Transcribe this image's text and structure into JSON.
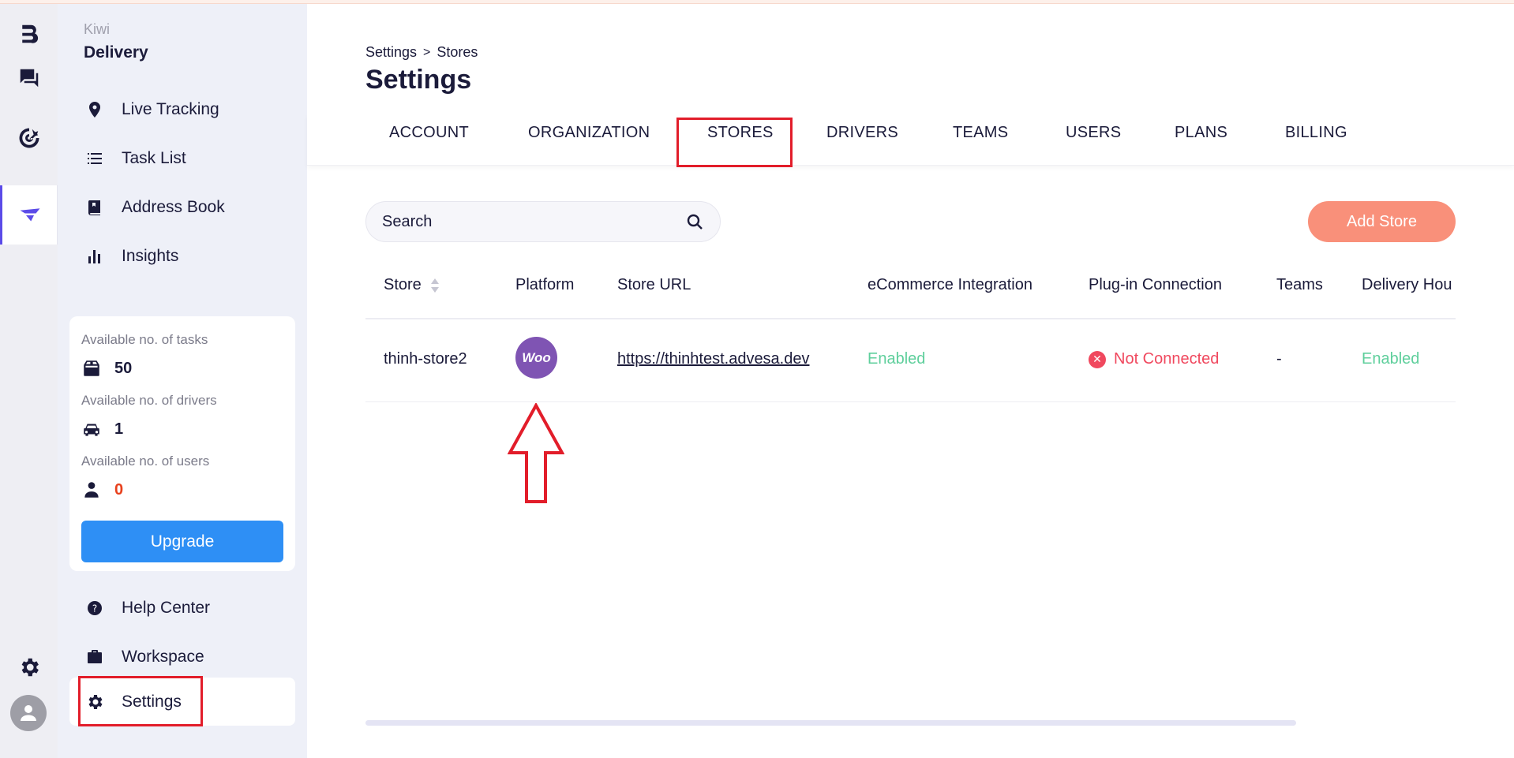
{
  "brand": {
    "workspace_name": "Kiwi",
    "app_name": "Delivery"
  },
  "rail": {
    "icons": [
      "logo-icon",
      "chat-icon",
      "target-icon",
      "dispatch-icon",
      "gear-icon",
      "user-avatar-icon"
    ]
  },
  "sidebar": {
    "items": [
      {
        "label": "Live Tracking",
        "icon": "map-pin-icon"
      },
      {
        "label": "Task List",
        "icon": "list-icon"
      },
      {
        "label": "Address Book",
        "icon": "book-icon"
      },
      {
        "label": "Insights",
        "icon": "bar-chart-icon"
      }
    ],
    "bottom_items": [
      {
        "label": "Help Center",
        "icon": "help-icon"
      },
      {
        "label": "Workspace",
        "icon": "briefcase-icon"
      },
      {
        "label": "Settings",
        "icon": "gear-icon"
      }
    ]
  },
  "usage": {
    "tasks_label": "Available no. of tasks",
    "tasks_value": "50",
    "drivers_label": "Available no. of drivers",
    "drivers_value": "1",
    "users_label": "Available no. of users",
    "users_value": "0",
    "upgrade_label": "Upgrade"
  },
  "breadcrumb": {
    "root": "Settings",
    "separator": ">",
    "current": "Stores"
  },
  "page_title": "Settings",
  "tabs": [
    {
      "label": "ACCOUNT"
    },
    {
      "label": "ORGANIZATION"
    },
    {
      "label": "STORES"
    },
    {
      "label": "DRIVERS"
    },
    {
      "label": "TEAMS"
    },
    {
      "label": "USERS"
    },
    {
      "label": "PLANS"
    },
    {
      "label": "BILLING"
    }
  ],
  "search": {
    "placeholder": "Search"
  },
  "add_store_label": "Add Store",
  "table": {
    "columns": [
      "Store",
      "Platform",
      "Store URL",
      "eCommerce Integration",
      "Plug-in Connection",
      "Teams",
      "Delivery Hou"
    ],
    "rows": [
      {
        "store": "thinh-store2",
        "platform_logo_text": "Woo",
        "store_url": "https://thinhtest.advesa.dev",
        "ecommerce_integration": "Enabled",
        "plugin_connection": "Not Connected",
        "teams": "-",
        "delivery_hours": "Enabled"
      }
    ]
  },
  "colors": {
    "accent": "#5b4be8",
    "upgrade": "#2e8ff5",
    "add_store": "#f9907a",
    "enabled": "#5fcf9c",
    "not_connected": "#f0485e",
    "woo": "#7f54b3",
    "annotation": "#e21d2a"
  }
}
